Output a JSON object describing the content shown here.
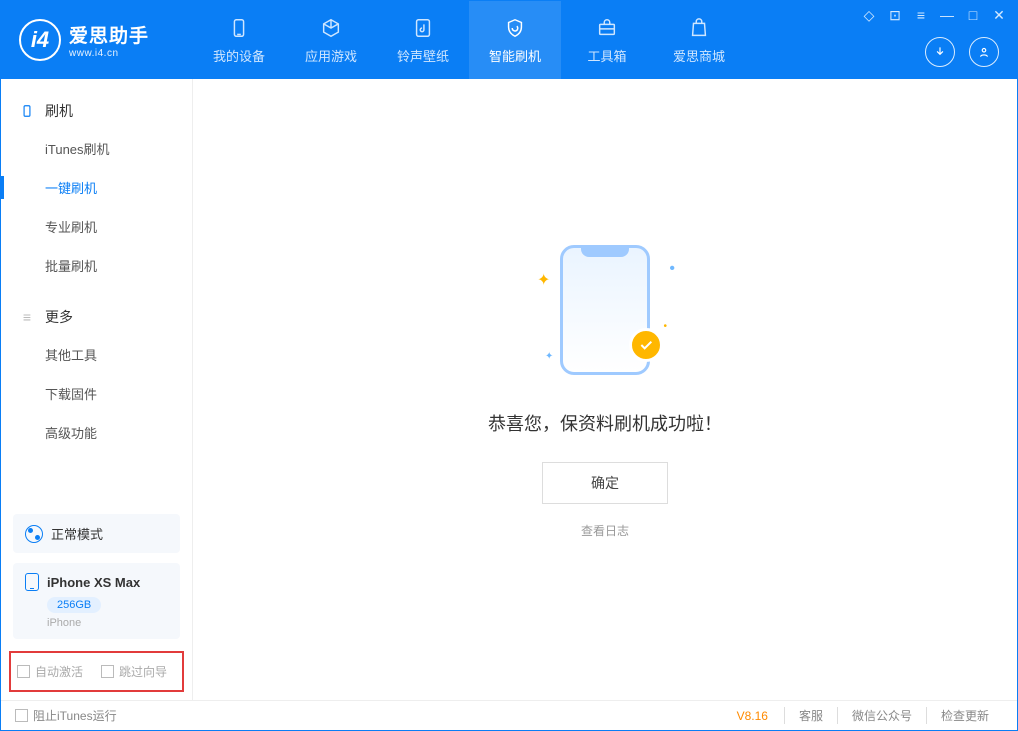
{
  "app": {
    "name_cn": "爱思助手",
    "name_en": "www.i4.cn"
  },
  "header_tabs": [
    {
      "label": "我的设备"
    },
    {
      "label": "应用游戏"
    },
    {
      "label": "铃声壁纸"
    },
    {
      "label": "智能刷机"
    },
    {
      "label": "工具箱"
    },
    {
      "label": "爱思商城"
    }
  ],
  "sidebar": {
    "section1_title": "刷机",
    "items1": [
      {
        "label": "iTunes刷机"
      },
      {
        "label": "一键刷机"
      },
      {
        "label": "专业刷机"
      },
      {
        "label": "批量刷机"
      }
    ],
    "section2_title": "更多",
    "items2": [
      {
        "label": "其他工具"
      },
      {
        "label": "下载固件"
      },
      {
        "label": "高级功能"
      }
    ]
  },
  "device": {
    "mode": "正常模式",
    "name": "iPhone XS Max",
    "storage": "256GB",
    "type": "iPhone"
  },
  "options": {
    "auto_activate": "自动激活",
    "skip_guide": "跳过向导"
  },
  "main": {
    "success_text": "恭喜您，保资料刷机成功啦！",
    "ok_button": "确定",
    "view_log": "查看日志"
  },
  "footer": {
    "block_itunes": "阻止iTunes运行",
    "version": "V8.16",
    "links": [
      "客服",
      "微信公众号",
      "检查更新"
    ]
  }
}
